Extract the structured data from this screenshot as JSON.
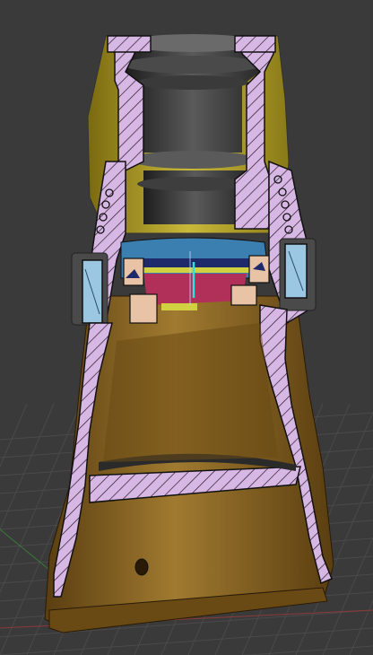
{
  "viewport": {
    "label": "",
    "background": "#3a3a3a",
    "grid_color": "#4a4a4a",
    "axis_x_color": "#8a3a3a",
    "axis_y_color": "#3a7a3a"
  },
  "model": {
    "section_fill": "#d7b7e3",
    "hatch_color": "#2a1a2a",
    "outline_color": "#111111",
    "body_gold": "#7a5a1e",
    "body_gold_light": "#a98a3a",
    "top_yellow": "#c9b93a",
    "bore_dark": "#2e2e2e",
    "bore_mid": "#5a5a5a",
    "bearing_blue": "#3a7fb0",
    "ring_red": "#b0305a",
    "ring_yellow": "#d0d040",
    "seal_light_blue": "#9cc7e3",
    "accent_cyan": "#30e0e0"
  }
}
